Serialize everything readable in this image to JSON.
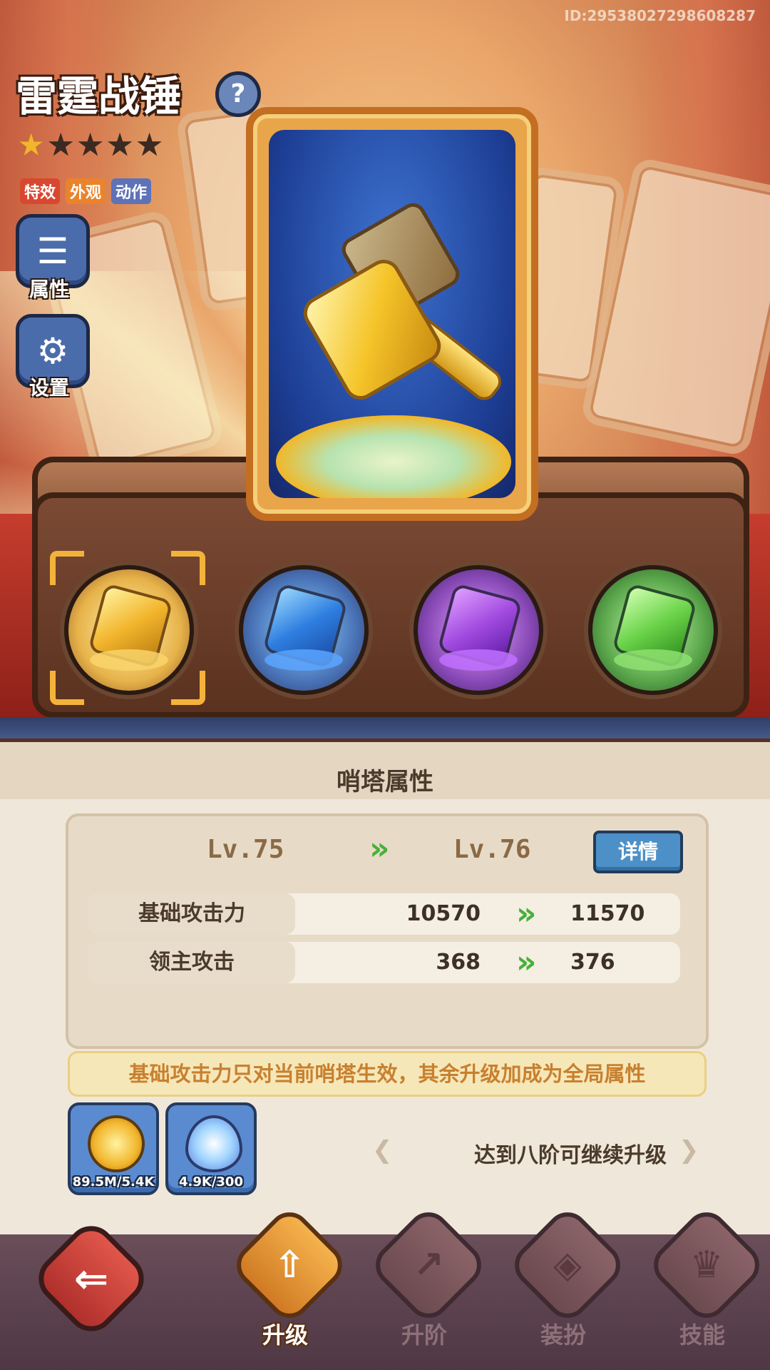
{
  "header": {
    "id_text": "ID:29538027298608287",
    "title": "雷霆战锤",
    "help_label": "?",
    "stars": {
      "filled": 1,
      "total": 5
    },
    "tags": [
      "特效",
      "外观",
      "动作"
    ]
  },
  "side_buttons": [
    {
      "label": "属性",
      "icon": "list-icon"
    },
    {
      "label": "设置",
      "icon": "gear-icon"
    }
  ],
  "slots": [
    {
      "name": "hammer",
      "selected": true,
      "color": "#f2b52c"
    },
    {
      "name": "blue-cube",
      "selected": false,
      "color": "#3a8de0"
    },
    {
      "name": "purple-cube",
      "selected": false,
      "color": "#a24be0"
    },
    {
      "name": "green-cube",
      "selected": false,
      "color": "#6bd34a"
    }
  ],
  "panel": {
    "title": "哨塔属性",
    "current_level": "Lv.75",
    "next_level": "Lv.76",
    "detail_button": "详情",
    "stats": [
      {
        "label": "基础攻击力",
        "current": "10570",
        "next": "11570"
      },
      {
        "label": "领主攻击",
        "current": "368",
        "next": "376"
      }
    ],
    "note": "基础攻击力只对当前哨塔生效，其余升级加成为全局属性",
    "resources": [
      {
        "type": "coin",
        "count": "89.5M/5.4K"
      },
      {
        "type": "crystal",
        "count": "4.9K/300"
      }
    ],
    "upgrade_hint": "达到八阶可继续升级"
  },
  "bottom_nav": {
    "back_icon": "back-arrow-icon",
    "tabs": [
      {
        "label": "升级",
        "active": true,
        "icon": "upgrade-icon"
      },
      {
        "label": "升阶",
        "active": false,
        "icon": "rank-up-icon"
      },
      {
        "label": "装扮",
        "active": false,
        "icon": "outfit-icon"
      },
      {
        "label": "技能",
        "active": false,
        "icon": "skill-icon"
      }
    ]
  },
  "colors": {
    "accent": "#f2b52c",
    "arrow_green": "#45b13a",
    "detail_blue": "#4d90c7",
    "note_text": "#c8802f"
  }
}
